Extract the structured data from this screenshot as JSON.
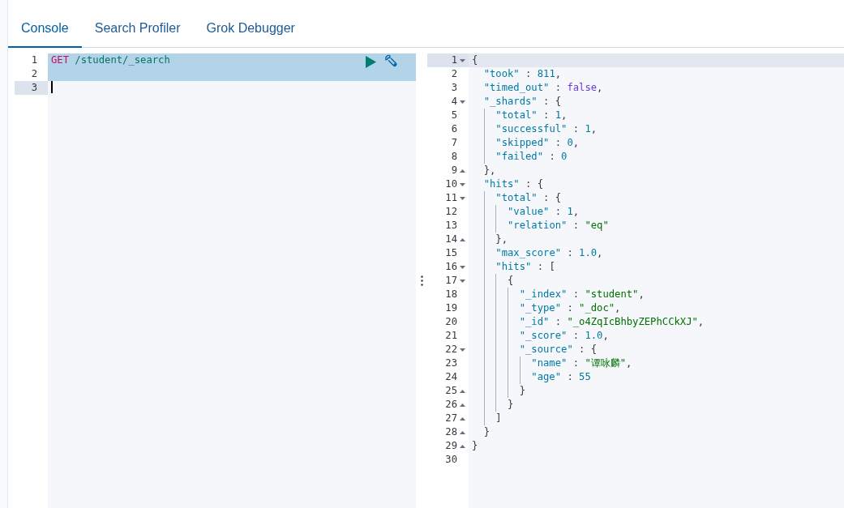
{
  "tabs": [
    {
      "label": "Console",
      "selected": true
    },
    {
      "label": "Search Profiler",
      "selected": false
    },
    {
      "label": "Grok Debugger",
      "selected": false
    }
  ],
  "request_editor": {
    "lines": [
      {
        "number": "1",
        "highlighted": true,
        "active": false,
        "cursor": false,
        "tokens": [
          {
            "kind": "method",
            "text": "GET"
          },
          {
            "kind": "url",
            "text": " /student/_search"
          }
        ]
      },
      {
        "number": "2",
        "highlighted": true,
        "active": false,
        "cursor": false
      },
      {
        "number": "3",
        "highlighted": false,
        "active": true,
        "cursor": true
      }
    ]
  },
  "response_editor": {
    "lines": [
      {
        "number": "1",
        "active": true,
        "fold_start": true,
        "tokens": [
          {
            "kind": "punc",
            "text": "{"
          }
        ]
      },
      {
        "number": "2",
        "active": false,
        "tokens": [
          {
            "kind": "key",
            "text": "  \"took\""
          },
          {
            "kind": "punc",
            "text": " : "
          },
          {
            "kind": "num",
            "text": "811"
          },
          {
            "kind": "punc",
            "text": ","
          }
        ]
      },
      {
        "number": "3",
        "active": false,
        "tokens": [
          {
            "kind": "key",
            "text": "  \"timed_out\""
          },
          {
            "kind": "punc",
            "text": " : "
          },
          {
            "kind": "bool",
            "text": "false"
          },
          {
            "kind": "punc",
            "text": ","
          }
        ]
      },
      {
        "number": "4",
        "active": false,
        "fold_start": true,
        "tokens": [
          {
            "kind": "key",
            "text": "  \"_shards\""
          },
          {
            "kind": "punc",
            "text": " : {"
          }
        ]
      },
      {
        "number": "5",
        "active": false,
        "tokens": [
          {
            "kind": "key",
            "text": "    \"total\""
          },
          {
            "kind": "punc",
            "text": " : "
          },
          {
            "kind": "num",
            "text": "1"
          },
          {
            "kind": "punc",
            "text": ","
          }
        ]
      },
      {
        "number": "6",
        "active": false,
        "tokens": [
          {
            "kind": "key",
            "text": "    \"successful\""
          },
          {
            "kind": "punc",
            "text": " : "
          },
          {
            "kind": "num",
            "text": "1"
          },
          {
            "kind": "punc",
            "text": ","
          }
        ]
      },
      {
        "number": "7",
        "active": false,
        "tokens": [
          {
            "kind": "key",
            "text": "    \"skipped\""
          },
          {
            "kind": "punc",
            "text": " : "
          },
          {
            "kind": "num",
            "text": "0"
          },
          {
            "kind": "punc",
            "text": ","
          }
        ]
      },
      {
        "number": "8",
        "active": false,
        "tokens": [
          {
            "kind": "key",
            "text": "    \"failed\""
          },
          {
            "kind": "punc",
            "text": " : "
          },
          {
            "kind": "num",
            "text": "0"
          }
        ]
      },
      {
        "number": "9",
        "active": false,
        "fold_end": true,
        "tokens": [
          {
            "kind": "punc",
            "text": "  },"
          }
        ]
      },
      {
        "number": "10",
        "active": false,
        "fold_start": true,
        "tokens": [
          {
            "kind": "key",
            "text": "  \"hits\""
          },
          {
            "kind": "punc",
            "text": " : {"
          }
        ]
      },
      {
        "number": "11",
        "active": false,
        "fold_start": true,
        "tokens": [
          {
            "kind": "key",
            "text": "    \"total\""
          },
          {
            "kind": "punc",
            "text": " : {"
          }
        ]
      },
      {
        "number": "12",
        "active": false,
        "tokens": [
          {
            "kind": "key",
            "text": "      \"value\""
          },
          {
            "kind": "punc",
            "text": " : "
          },
          {
            "kind": "num",
            "text": "1"
          },
          {
            "kind": "punc",
            "text": ","
          }
        ]
      },
      {
        "number": "13",
        "active": false,
        "tokens": [
          {
            "kind": "key",
            "text": "      \"relation\""
          },
          {
            "kind": "punc",
            "text": " : "
          },
          {
            "kind": "str",
            "text": "\"eq\""
          }
        ]
      },
      {
        "number": "14",
        "active": false,
        "fold_end": true,
        "tokens": [
          {
            "kind": "punc",
            "text": "    },"
          }
        ]
      },
      {
        "number": "15",
        "active": false,
        "tokens": [
          {
            "kind": "key",
            "text": "    \"max_score\""
          },
          {
            "kind": "punc",
            "text": " : "
          },
          {
            "kind": "num",
            "text": "1.0"
          },
          {
            "kind": "punc",
            "text": ","
          }
        ]
      },
      {
        "number": "16",
        "active": false,
        "fold_start": true,
        "tokens": [
          {
            "kind": "key",
            "text": "    \"hits\""
          },
          {
            "kind": "punc",
            "text": " : ["
          }
        ]
      },
      {
        "number": "17",
        "active": false,
        "fold_start": true,
        "tokens": [
          {
            "kind": "punc",
            "text": "      {"
          }
        ]
      },
      {
        "number": "18",
        "active": false,
        "tokens": [
          {
            "kind": "key",
            "text": "        \"_index\""
          },
          {
            "kind": "punc",
            "text": " : "
          },
          {
            "kind": "str",
            "text": "\"student\""
          },
          {
            "kind": "punc",
            "text": ","
          }
        ]
      },
      {
        "number": "19",
        "active": false,
        "tokens": [
          {
            "kind": "key",
            "text": "        \"_type\""
          },
          {
            "kind": "punc",
            "text": " : "
          },
          {
            "kind": "str",
            "text": "\"_doc\""
          },
          {
            "kind": "punc",
            "text": ","
          }
        ]
      },
      {
        "number": "20",
        "active": false,
        "tokens": [
          {
            "kind": "key",
            "text": "        \"_id\""
          },
          {
            "kind": "punc",
            "text": " : "
          },
          {
            "kind": "str",
            "text": "\"_o4ZqIcBhbyZEPhCCkXJ\""
          },
          {
            "kind": "punc",
            "text": ","
          }
        ]
      },
      {
        "number": "21",
        "active": false,
        "tokens": [
          {
            "kind": "key",
            "text": "        \"_score\""
          },
          {
            "kind": "punc",
            "text": " : "
          },
          {
            "kind": "num",
            "text": "1.0"
          },
          {
            "kind": "punc",
            "text": ","
          }
        ]
      },
      {
        "number": "22",
        "active": false,
        "fold_start": true,
        "tokens": [
          {
            "kind": "key",
            "text": "        \"_source\""
          },
          {
            "kind": "punc",
            "text": " : {"
          }
        ]
      },
      {
        "number": "23",
        "active": false,
        "tokens": [
          {
            "kind": "key",
            "text": "          \"name\""
          },
          {
            "kind": "punc",
            "text": " : "
          },
          {
            "kind": "str",
            "text": "\"谭咏麟\""
          },
          {
            "kind": "punc",
            "text": ","
          }
        ]
      },
      {
        "number": "24",
        "active": false,
        "tokens": [
          {
            "kind": "key",
            "text": "          \"age\""
          },
          {
            "kind": "punc",
            "text": " : "
          },
          {
            "kind": "num",
            "text": "55"
          }
        ]
      },
      {
        "number": "25",
        "active": false,
        "fold_end": true,
        "tokens": [
          {
            "kind": "punc",
            "text": "        }"
          }
        ]
      },
      {
        "number": "26",
        "active": false,
        "fold_end": true,
        "tokens": [
          {
            "kind": "punc",
            "text": "      }"
          }
        ]
      },
      {
        "number": "27",
        "active": false,
        "fold_end": true,
        "tokens": [
          {
            "kind": "punc",
            "text": "    ]"
          }
        ]
      },
      {
        "number": "28",
        "active": false,
        "fold_end": true,
        "tokens": [
          {
            "kind": "punc",
            "text": "  }"
          }
        ]
      },
      {
        "number": "29",
        "active": false,
        "fold_end": true,
        "tokens": [
          {
            "kind": "punc",
            "text": "}"
          }
        ]
      },
      {
        "number": "30",
        "active": false
      }
    ]
  }
}
